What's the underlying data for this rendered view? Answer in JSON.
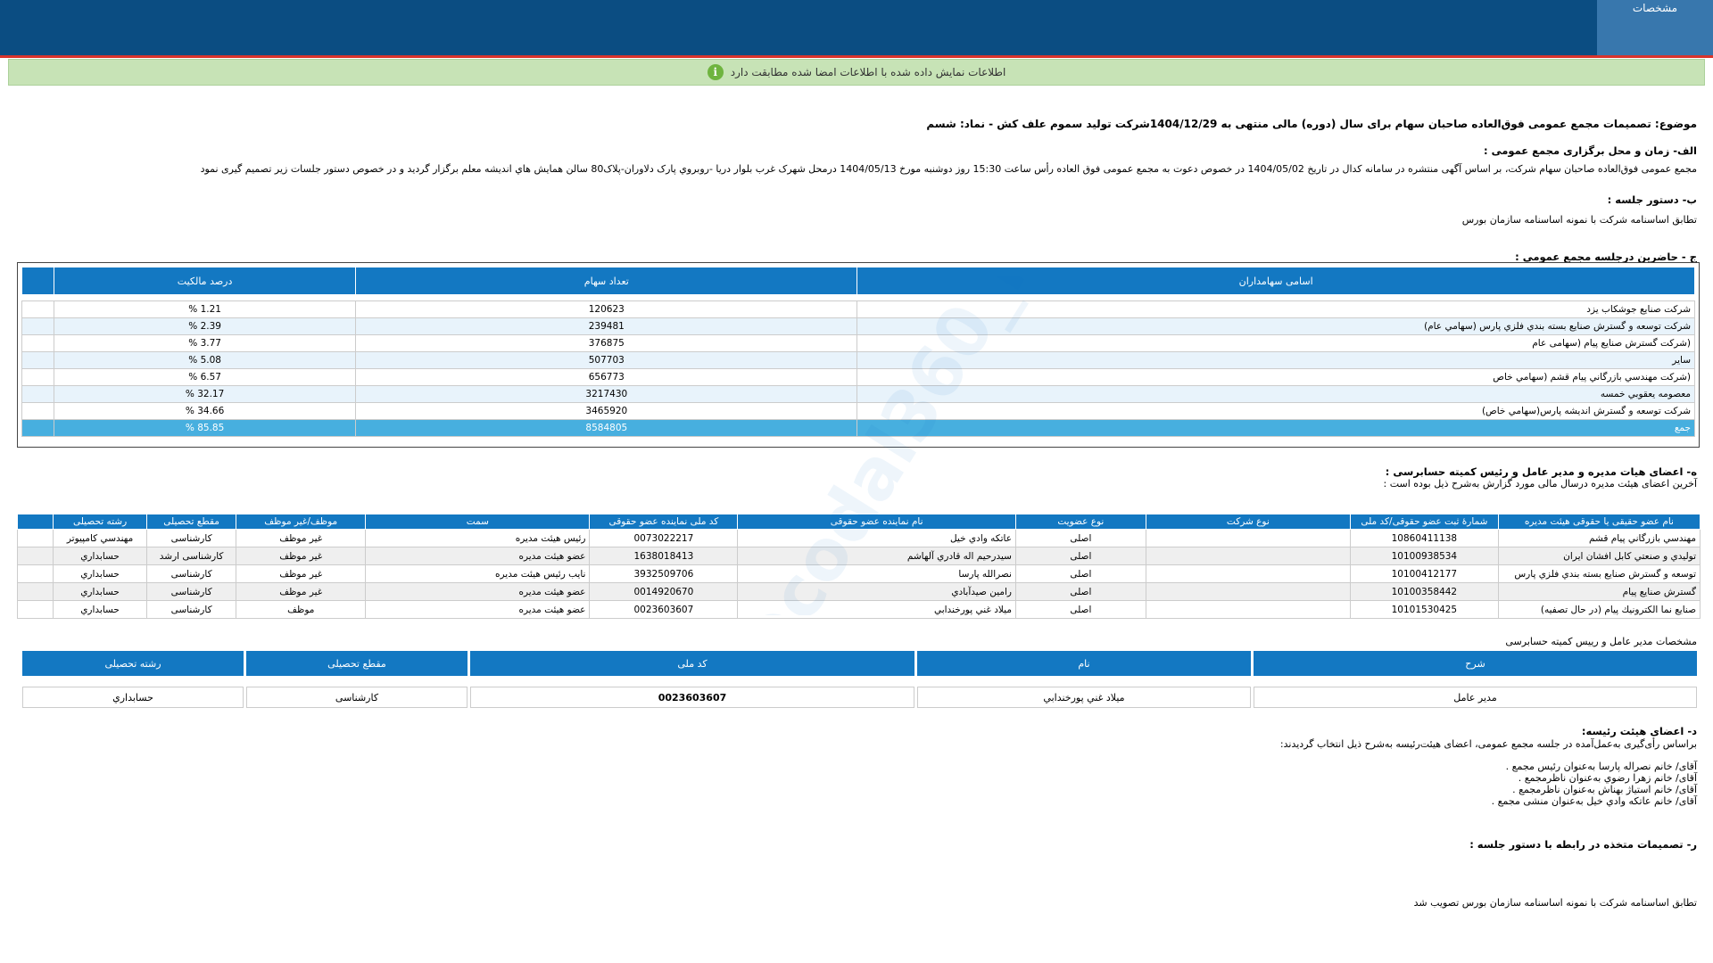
{
  "header": {
    "tab_label": "مشخصات"
  },
  "info_bar": {
    "icon": "i",
    "text": "اطلاعات نمایش داده شده با اطلاعات امضا شده مطابقت دارد"
  },
  "subject": "موضوع: تصمیمات مجمع عمومی فوق‌العاده صاحبان سهام برای سال (دوره) مالی منتهی به 1404/12/29شرکت تولید سموم علف کش - نماد: شسم",
  "section_a": {
    "title": "الف- زمان و محل برگزاری مجمع عمومی :",
    "text": "مجمع عمومی فوق‌العاده صاحبان سهام شرکت، بر اساس آگهی منتشره در سامانه کدال در تاریخ 1404/05/02 در خصوص دعوت به مجمع عمومی فوق العاده رأس ساعت 15:30 روز دوشنبه مورخ 1404/05/13 درمحل شهرک غرب بلوار دریا -روبروي پارک دلاوران-پلاک80 سالن همايش هاي انديشه معلم   برگزار گردید و در خصوص دستور جلسات زیر تصمیم گیری نمود"
  },
  "section_b": {
    "title": "ب- دستور جلسه :",
    "text": "تطابق اساسنامه شرکت با نمونه اساسنامه سازمان بورس"
  },
  "section_c": {
    "title": "ج - حاضرین درجلسه مجمع عمومی :",
    "columns": [
      "اسامی سهامداران",
      "تعداد سهام",
      "درصد مالکیت"
    ],
    "rows": [
      [
        "شرکت صنايع جوشکاب يزد",
        "120623",
        "1.21 %"
      ],
      [
        "شرکت توسعه و گسترش صنايع بسته بندي فلزي پارس (سهامي عام)",
        "239481",
        "2.39 %"
      ],
      [
        "(شرکت گسترش صنايع پيام (سهامی عام",
        "376875",
        "3.77 %"
      ],
      [
        "ساير",
        "507703",
        "5.08 %"
      ],
      [
        "(شرکت مهندسي بازرگاني پيام قشم (سهامي خاص",
        "656773",
        "6.57 %"
      ],
      [
        "معصومه يعقوبي خمسه",
        "3217430",
        "32.17 %"
      ],
      [
        "شرکت توسعه و گسترش انديشه پارس(سهامي خاص)",
        "3465920",
        "34.66 %"
      ]
    ],
    "total": [
      "جمع",
      "8584805",
      "85.85 %"
    ]
  },
  "section_d": {
    "title": "ه- اعضای هیات مدیره و مدیر عامل و رئیس کمیته حسابرسی :",
    "subtitle": "آخرین اعضای هیئت مدیره درسال مالی مورد گزارش به‌شرح ذیل بوده است :",
    "columns": [
      "نام عضو حقیقی یا حقوقی هیئت مدیره",
      "شمارۀ ثبت عضو حقوقی/کد ملی",
      "نوع شرکت",
      "نوع عضویت",
      "نام نماینده عضو حقوقی",
      "کد ملی نماینده عضو حقوقی",
      "سمت",
      "موظف/غیر موظف",
      "مقطع تحصیلی",
      "رشته تحصیلی"
    ],
    "rows": [
      [
        "مهندسي بازرگاني پيام قشم",
        "10860411138",
        "",
        "اصلی",
        "عاتکه وادي خيل",
        "0073022217",
        "رئیس هیئت مدیره",
        "غیر موظف",
        "کارشناسی",
        "مهندسي كامپيوتر"
      ],
      [
        "توليدي و صنعتي كابل افشان ايران",
        "10100938534",
        "",
        "اصلی",
        "سيدرحيم اله قادري آلهاشم",
        "1638018413",
        "عضو هیئت مدیره",
        "غیر موظف",
        "کارشناسی ارشد",
        "حسابداري"
      ],
      [
        "توسعه و گسترش صنايع بسته بندي فلزي پارس",
        "10100412177",
        "",
        "اصلی",
        "نصرالله پارسا",
        "3932509706",
        "نایب رئیس هیئت مدیره",
        "غیر موظف",
        "کارشناسی",
        "حسابداري"
      ],
      [
        "گسترش صنايع پيام",
        "10100358442",
        "",
        "اصلی",
        "رامين صيدآبادي",
        "0014920670",
        "عضو هیئت مدیره",
        "غیر موظف",
        "کارشناسی",
        "حسابداري"
      ],
      [
        "صنايع نما الكترونيك پيام (در حال تصفيه)",
        "10101530425",
        "",
        "اصلی",
        "ميلاد غني پورخندابي",
        "0023603607",
        "عضو هیئت مدیره",
        "موظف",
        "کارشناسی",
        "حسابداري"
      ]
    ]
  },
  "ceo": {
    "title": "مشخصات مدیر عامل و رییس کمیته حسابرسی",
    "columns": [
      "شرح",
      "نام",
      "کد ملی",
      "مقطع تحصیلی",
      "رشته تحصیلی"
    ],
    "row": [
      "مدیر عامل",
      "ميلاد غني پورخندابي",
      "0023603607",
      "کارشناسی",
      "حسابداري"
    ]
  },
  "section_e": {
    "title": "د- اعضای هیئت رئیسه:",
    "intro": "براساس رأی‌گیری به‌عمل‌آمده در جلسه مجمع عمومی، اعضای هیئت‌رئیسه به‌شرح ذیل انتخاب گردیدند:",
    "lines": [
      "آقای/ خانم  نصراله پارسا  به‌عنوان رئیس مجمع .",
      "آقای/ خانم  زهرا رضوي  به‌عنوان ناظرمجمع .",
      "آقای/ خانم  استياژ بهناش  به‌عنوان ناظرمجمع .",
      "آقای/ خانم  عاتكه وادي خيل  به‌عنوان منشی مجمع ."
    ]
  },
  "section_f": {
    "title": "ر- تصمیمات متخذه در رابطه با دستور جلسه :",
    "text": "تطابق اساسنامه شرکت با نمونه اساسنامه سازمان بورس تصویب شد"
  },
  "watermark": "@codal360_ir",
  "colors": {
    "header": "#0b4d82",
    "table_head": "#1378c2",
    "total_row": "#47afdf",
    "info_bg": "#c7e3b6"
  }
}
